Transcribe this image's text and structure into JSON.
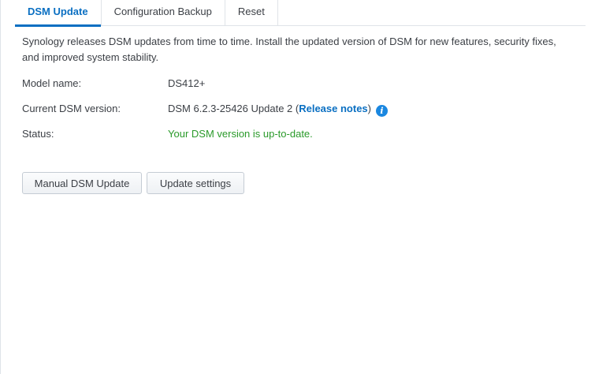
{
  "tabs": [
    {
      "label": "DSM Update",
      "active": true
    },
    {
      "label": "Configuration Backup",
      "active": false
    },
    {
      "label": "Reset",
      "active": false
    }
  ],
  "description": "Synology releases DSM updates from time to time. Install the updated version of DSM for new features, security fixes, and improved system stability.",
  "info": {
    "model_label": "Model name:",
    "model_value": "DS412+",
    "version_label": "Current DSM version:",
    "version_value": "DSM 6.2.3-25426 Update 2 (",
    "release_notes_label": "Release notes",
    "version_suffix": ")",
    "status_label": "Status:",
    "status_value": "Your DSM version is up-to-date."
  },
  "buttons": {
    "manual_update": "Manual DSM Update",
    "update_settings": "Update settings"
  },
  "colors": {
    "accent": "#0a6fc2",
    "status_ok": "#2a9a2a",
    "info_icon": "#1a87e0"
  },
  "icons": {
    "info": "info-icon"
  }
}
